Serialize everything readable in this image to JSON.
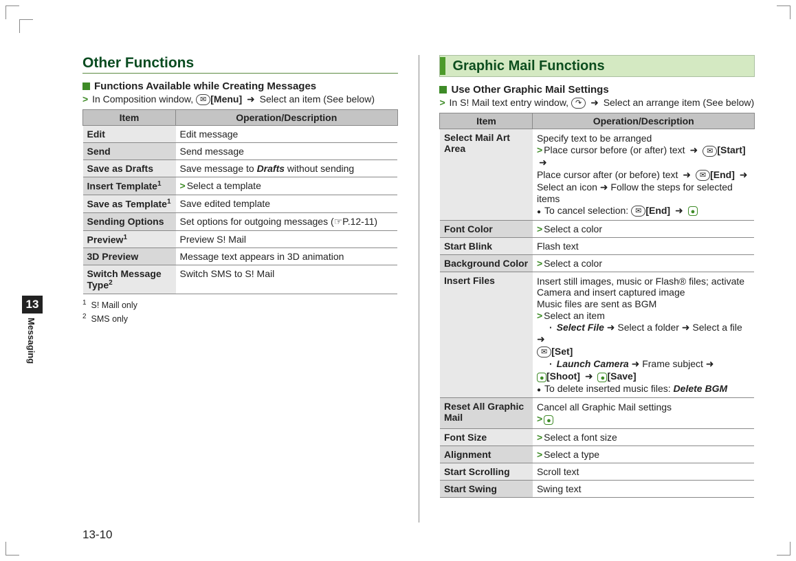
{
  "page_number": "13-10",
  "chapter_number": "13",
  "chapter_label": "Messaging",
  "left": {
    "title": "Other Functions",
    "sub_title": "Functions Available while Creating Messages",
    "intro_prefix": "In Composition window, ",
    "intro_btn": "✉",
    "intro_bold": "[Menu]",
    "intro_suffix": " Select an item (See below)",
    "th_item": "Item",
    "th_desc": "Operation/Description",
    "rows": [
      {
        "item": "Edit",
        "desc": "Edit message"
      },
      {
        "item": "Send",
        "desc": "Send message"
      },
      {
        "item": "Save as Drafts",
        "desc_pre": "Save message to ",
        "desc_ital": "Drafts",
        "desc_post": " without sending"
      },
      {
        "item": "Insert Template",
        "sup": "1",
        "gt_desc": "Select a template"
      },
      {
        "item": "Save as Template",
        "sup": "1",
        "desc": "Save edited template"
      },
      {
        "item": "Sending Options",
        "desc": "Set options for outgoing messages (☞P.12-11)"
      },
      {
        "item": "Preview",
        "sup": "1",
        "desc": "Preview S! Mail"
      },
      {
        "item": "3D Preview",
        "desc": "Message text appears in 3D animation"
      },
      {
        "item": "Switch Message Type",
        "sup": "2",
        "desc": "Switch SMS to S! Mail"
      }
    ],
    "footnote1": "S! Maill only",
    "footnote2": "SMS only"
  },
  "right": {
    "banner_title": "Graphic Mail Functions",
    "sub_title": "Use Other Graphic Mail Settings",
    "intro_prefix": "In S! Mail text entry window, ",
    "intro_btn": "↷",
    "intro_suffix": " Select an arrange item (See below)",
    "th_item": "Item",
    "th_desc": "Operation/Description",
    "rows": {
      "select_mail_art": {
        "item": "Select Mail Art Area",
        "line1": "Specify text to be arranged",
        "gt_line_a": "Place cursor before (or after) text ",
        "start_label": "[Start]",
        "gt_line_b": "Place cursor after (or before) text ",
        "end_label": "[End]",
        "gt_line_c": "Select an icon ➜ Follow the steps for selected items",
        "bullet": "To cancel selection: ",
        "end_label2": "[End]"
      },
      "font_color": {
        "item": "Font Color",
        "gt_desc": "Select a color"
      },
      "start_blink": {
        "item": "Start Blink",
        "desc": "Flash text"
      },
      "bg_color": {
        "item": "Background Color",
        "gt_desc": "Select a color"
      },
      "insert_files": {
        "item": "Insert Files",
        "line1": "Insert still images, music or Flash® files; activate Camera and insert captured image",
        "line2": "Music files are sent as BGM",
        "gt_desc": "Select an item",
        "sf_label": "Select File",
        "sf_tail": " ➜ Select a folder ➜ Select a file ➜ ",
        "set_label": "[Set]",
        "lc_label": "Launch Camera",
        "lc_tail": " ➜ Frame subject ➜ ",
        "shoot_label": "[Shoot]",
        "save_label": "[Save]",
        "bullet": "To delete inserted music files: ",
        "del_label": "Delete BGM"
      },
      "reset_all": {
        "item": "Reset All Graphic Mail",
        "desc": "Cancel all Graphic Mail settings"
      },
      "font_size": {
        "item": "Font Size",
        "gt_desc": "Select a font size"
      },
      "alignment": {
        "item": "Alignment",
        "gt_desc": "Select a type"
      },
      "start_scroll": {
        "item": "Start Scrolling",
        "desc": "Scroll text"
      },
      "start_swing": {
        "item": "Start Swing",
        "desc": "Swing text"
      }
    }
  }
}
